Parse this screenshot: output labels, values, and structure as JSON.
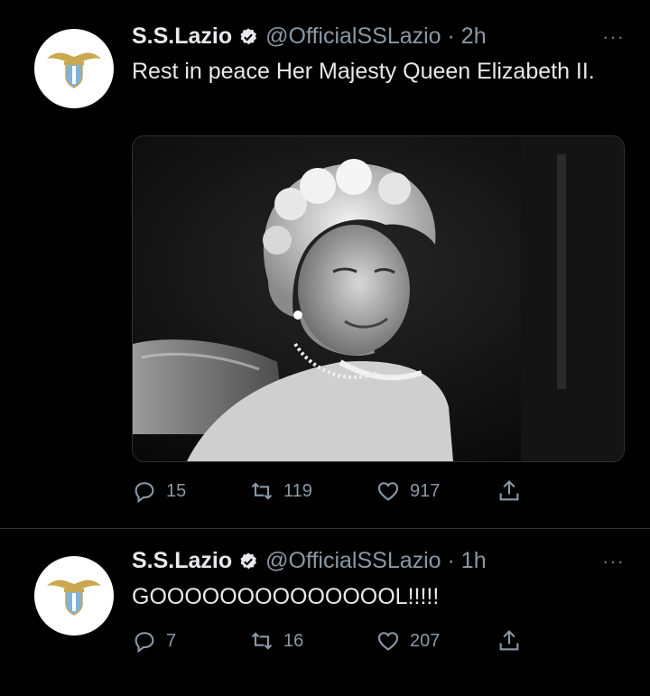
{
  "tweets": [
    {
      "name": "S.S.Lazio",
      "handle": "@OfficialSSLazio · 2h",
      "text": "Rest in peace Her Majesty Queen Elizabeth II.",
      "replies": "15",
      "retweets": "119",
      "likes": "917",
      "more": "···"
    },
    {
      "name": "S.S.Lazio",
      "handle": "@OfficialSSLazio · 1h",
      "text": "GOOOOOOOOOOOOOOL!!!!!",
      "replies": "7",
      "retweets": "16",
      "likes": "207",
      "more": "···"
    }
  ],
  "colors": {
    "background": "#000000",
    "text": "#e7e9ea",
    "muted": "#8b98a5",
    "lazio_blue": "#7fb3dc",
    "eagle_gold": "#c9a84f"
  },
  "icons": [
    "verified-icon",
    "reply-icon",
    "retweet-icon",
    "like-icon",
    "share-icon",
    "more-icon",
    "lazio-crest-icon"
  ]
}
